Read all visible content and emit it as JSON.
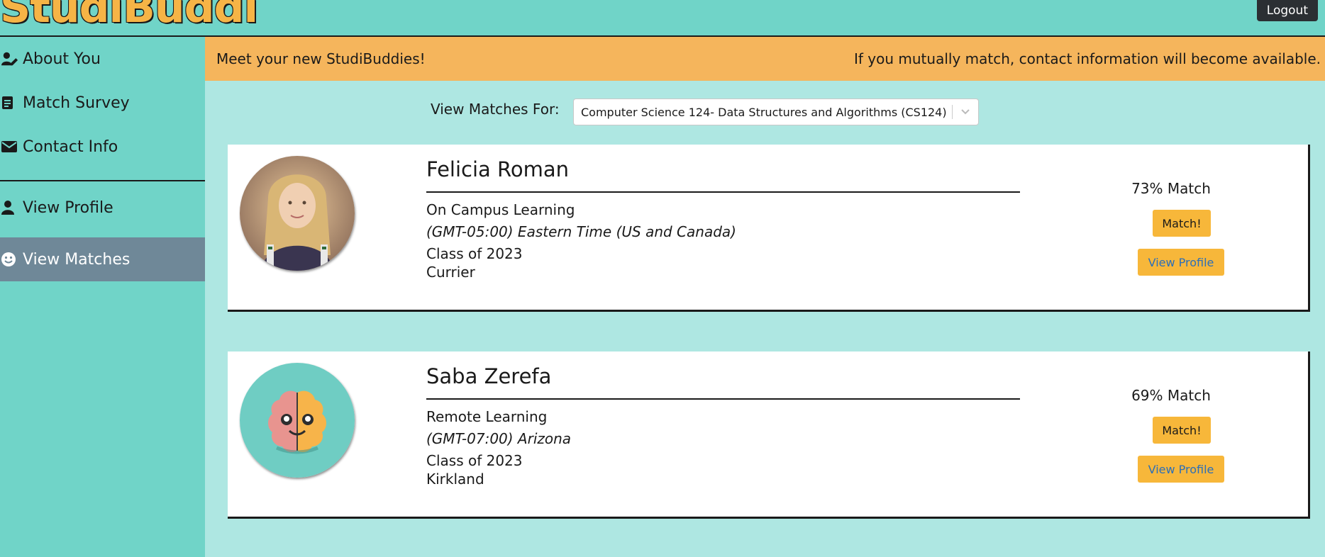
{
  "header": {
    "brand": "StudiBuddi",
    "logout_label": "Logout"
  },
  "sidebar": {
    "items": [
      {
        "label": "About You",
        "icon": "user-edit-icon"
      },
      {
        "label": "Match Survey",
        "icon": "survey-icon"
      },
      {
        "label": "Contact Info",
        "icon": "envelope-icon"
      },
      {
        "label": "View Profile",
        "icon": "user-icon"
      },
      {
        "label": "View Matches",
        "icon": "smile-icon",
        "active": true
      }
    ]
  },
  "banner": {
    "left_text": "Meet your new StudiBuddies!",
    "right_text": "If you mutually match, contact information will become available."
  },
  "filter": {
    "label": "View Matches For:",
    "selected": "Computer Science 124- Data Structures and Algorithms (CS124)"
  },
  "matches": [
    {
      "name": "Felicia Roman",
      "learning": "On Campus Learning",
      "timezone": "(GMT-05:00) Eastern Time (US and Canada)",
      "class_year": "Class of 2023",
      "house": "Currier",
      "match_percent": "73% Match",
      "match_label": "Match!",
      "profile_label": "View Profile",
      "avatar": "photo-avatar"
    },
    {
      "name": "Saba Zerefa",
      "learning": "Remote Learning",
      "timezone": "(GMT-07:00) Arizona",
      "class_year": "Class of 2023",
      "house": "Kirkland",
      "match_percent": "69% Match",
      "match_label": "Match!",
      "profile_label": "View Profile",
      "avatar": "brain-avatar"
    }
  ],
  "colors": {
    "header_bg": "#70d4c8",
    "page_bg": "#aee7e2",
    "banner_bg": "#f5b55c",
    "button_bg": "#f7b73a",
    "active_nav": "#6f8898",
    "brand": "#f6b446"
  }
}
